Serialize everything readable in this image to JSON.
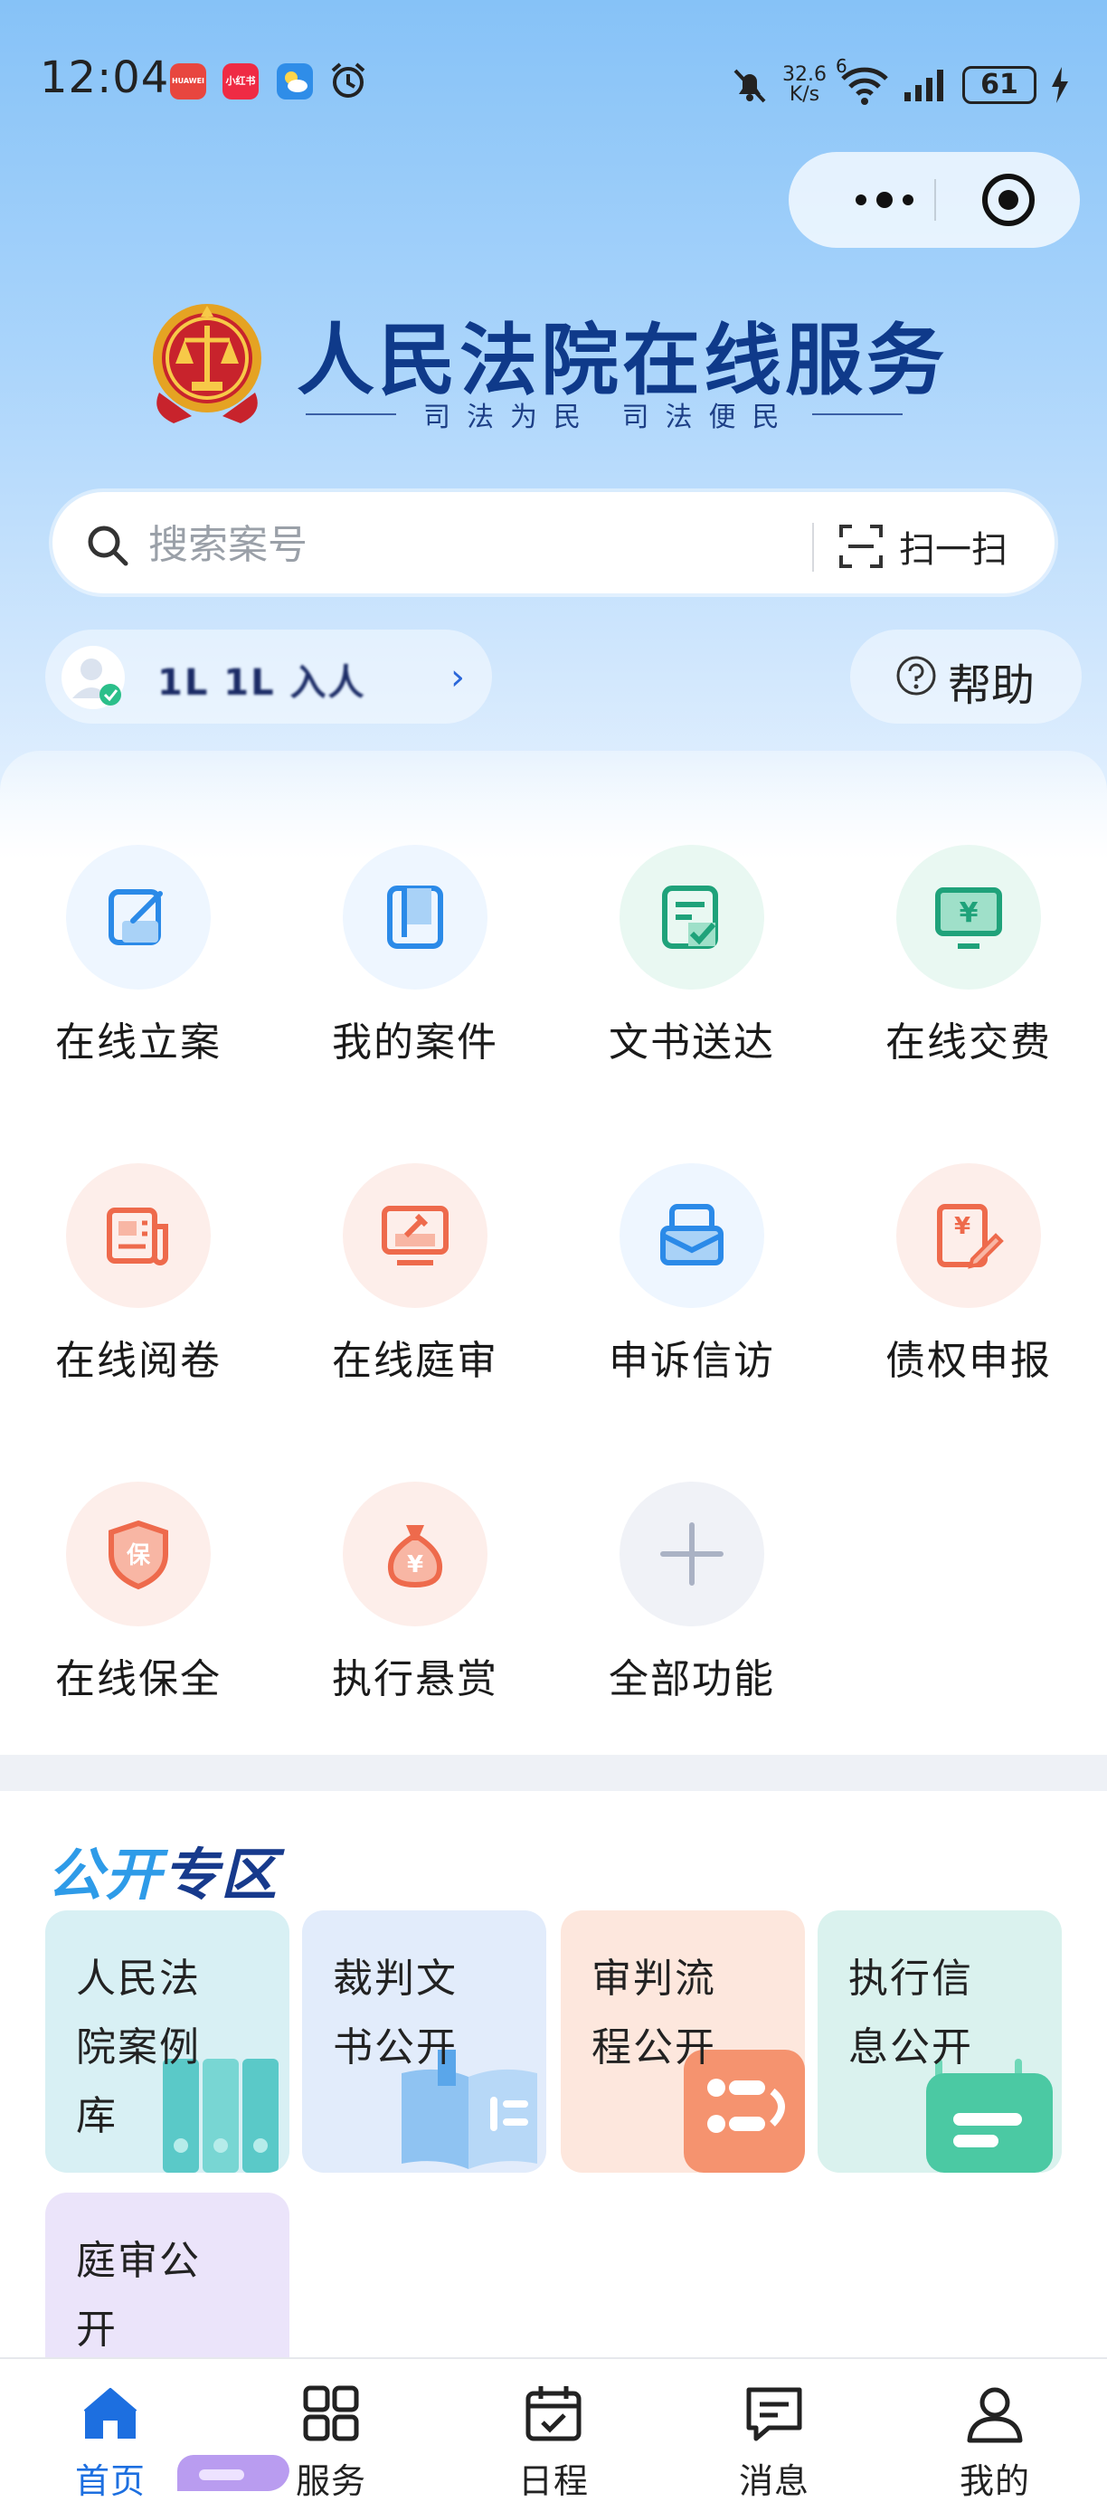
{
  "status_bar": {
    "time": "12:04",
    "app_badges": [
      {
        "name": "huawei-badge",
        "text": "HUAWEI",
        "color": "#e8463f"
      },
      {
        "name": "xiaohongshu-badge",
        "text": "小红书",
        "color": "#ef2b44"
      },
      {
        "name": "weather-badge",
        "text": "",
        "color": "#2f8de8"
      }
    ],
    "network_speed_value": "32.6",
    "network_speed_unit": "K/s",
    "wifi_label": "6",
    "battery": "61"
  },
  "header": {
    "title": "人民法院在线服务",
    "slogan": "司法为民  司法便民"
  },
  "search": {
    "placeholder": "搜索案号",
    "scan_label": "扫一扫"
  },
  "user": {
    "name_masked": "1L   1L   入人"
  },
  "help": {
    "label": "帮助"
  },
  "functions": [
    {
      "label": "在线立案",
      "icon": "edit-icon"
    },
    {
      "label": "我的案件",
      "icon": "casebook-icon"
    },
    {
      "label": "文书送达",
      "icon": "document-check-icon"
    },
    {
      "label": "在线交费",
      "icon": "payment-icon"
    },
    {
      "label": "在线阅卷",
      "icon": "newspaper-icon"
    },
    {
      "label": "在线庭审",
      "icon": "gavel-screen-icon"
    },
    {
      "label": "申诉信访",
      "icon": "mailbox-icon"
    },
    {
      "label": "债权申报",
      "icon": "claim-edit-icon"
    },
    {
      "label": "在线保全",
      "icon": "shield-icon"
    },
    {
      "label": "执行悬赏",
      "icon": "money-bag-icon"
    },
    {
      "label": "全部功能",
      "icon": "plus-icon"
    }
  ],
  "public_zone": {
    "title_part1": "公开",
    "title_part2": "专区",
    "tiles": [
      {
        "lines": [
          "人民法",
          "院案例",
          "库"
        ]
      },
      {
        "lines": [
          "裁判文",
          "书公开"
        ]
      },
      {
        "lines": [
          "审判流",
          "程公开"
        ]
      },
      {
        "lines": [
          "执行信",
          "息公开"
        ]
      },
      {
        "lines": [
          "庭审公",
          "开"
        ]
      }
    ]
  },
  "tab_bar": {
    "tabs": [
      {
        "label": "首页",
        "active": true
      },
      {
        "label": "服务",
        "active": false
      },
      {
        "label": "日程",
        "active": false
      },
      {
        "label": "消息",
        "active": false
      },
      {
        "label": "我的",
        "active": false
      }
    ]
  },
  "colors": {
    "primary": "#1d6fe0",
    "title_navy": "#0f3a8a",
    "public_blue": "#2e9be8"
  }
}
